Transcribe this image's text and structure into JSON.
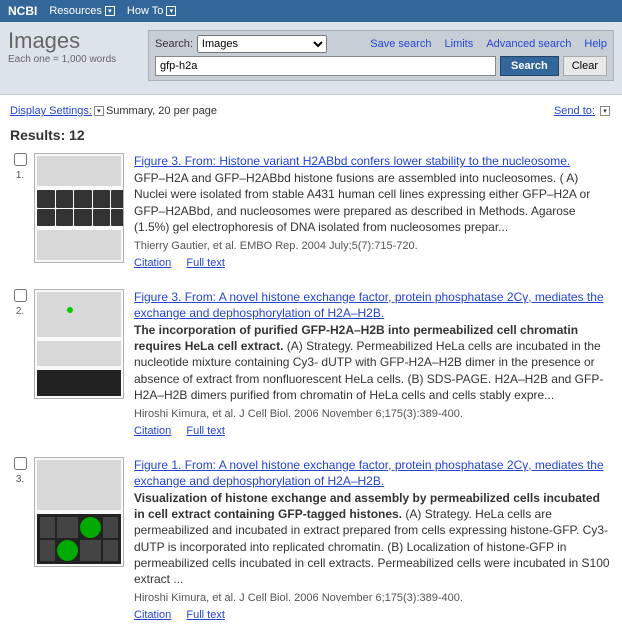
{
  "topbar": {
    "logo": "NCBI",
    "items": [
      "Resources",
      "How To"
    ]
  },
  "header": {
    "title": "Images",
    "subtitle": "Each one = 1,000 words"
  },
  "search": {
    "label": "Search:",
    "select_value": "Images",
    "links": [
      "Save search",
      "Limits",
      "Advanced search",
      "Help"
    ],
    "input_value": "gfp-h2a",
    "btn_search": "Search",
    "btn_clear": "Clear"
  },
  "toolbar": {
    "display_settings": "Display Settings:",
    "summary": "Summary, 20 per page",
    "sendto": "Send to:"
  },
  "results_label": "Results: 12",
  "results": [
    {
      "num": "1.",
      "title": "Figure 3. From: Histone variant H2ABbd confers lower stability to the nucleosome.",
      "snippet_bold": "",
      "snippet": "GFP–H2A and GFP–H2ABbd histone fusions are assembled into nucleosomes. ( A) Nuclei were isolated from stable A431 human cell lines expressing either GFP–H2A or GFP–H2ABbd, and nucleosomes were prepared as described in Methods. Agarose (1.5%) gel electrophoresis of DNA isolated from nucleosomes prepar...",
      "citation": "Thierry Gautier, et al. EMBO Rep. 2004 July;5(7):715-720.",
      "links": [
        "Citation",
        "Full text"
      ]
    },
    {
      "num": "2.",
      "title": "Figure 3. From: A novel histone exchange factor, protein phosphatase 2Cγ, mediates the exchange and dephosphorylation of H2A–H2B.",
      "snippet_bold": "The incorporation of purified GFP-H2A–H2B into permeabilized cell chromatin requires HeLa cell extract.",
      "snippet": " (A) Strategy. Permeabilized HeLa cells are incubated in the nucleotide mixture containing Cy3- dUTP with GFP-H2A–H2B dimer in the presence or absence of extract from nonfluorescent HeLa cells. (B) SDS-PAGE. H2A–H2B and GFP-H2A–H2B dimers purified from chromatin of HeLa cells and cells stably expre...",
      "citation": "Hiroshi Kimura, et al. J Cell Biol. 2006 November 6;175(3):389-400.",
      "links": [
        "Citation",
        "Full text"
      ]
    },
    {
      "num": "3.",
      "title": "Figure 1. From: A novel histone exchange factor, protein phosphatase 2Cγ, mediates the exchange and dephosphorylation of H2A–H2B.",
      "snippet_bold": "Visualization of histone exchange and assembly by permeabilized cells incubated in cell extract containing GFP-tagged histones.",
      "snippet": " (A) Strategy. HeLa cells are permeabilized and incubated in extract prepared from cells expressing histone-GFP. Cy3-dUTP is incorporated into replicated chromatin. (B) Localization of histone-GFP in permeabilized cells incubated in cell extracts. Permeabilized cells were incubated in S100 extract ...",
      "citation": "Hiroshi Kimura, et al. J Cell Biol. 2006 November 6;175(3):389-400.",
      "links": [
        "Citation",
        "Full text"
      ]
    }
  ]
}
